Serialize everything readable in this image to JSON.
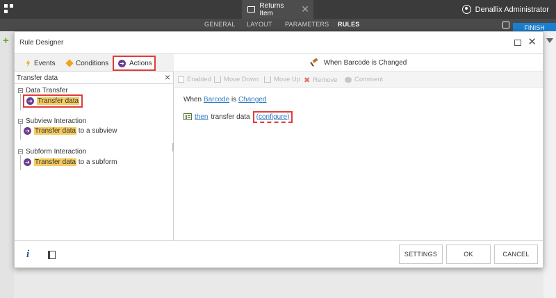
{
  "app": {
    "doc_tab_title": "Returns Item",
    "user_name": "Denallix Administrator"
  },
  "nav": {
    "items": [
      "GENERAL",
      "LAYOUT",
      "PARAMETERS",
      "RULES"
    ],
    "active": "RULES",
    "finish_label": "FINISH"
  },
  "dialog": {
    "title": "Rule Designer",
    "tabs": {
      "events": "Events",
      "conditions": "Conditions",
      "actions": "Actions"
    },
    "search": {
      "value": "Transfer data"
    },
    "tree": [
      {
        "group": "Data Transfer",
        "item_highlight": "Transfer data",
        "item_suffix": ""
      },
      {
        "group": "Subview Interaction",
        "item_highlight": "Transfer data",
        "item_suffix": " to a subview"
      },
      {
        "group": "Subform Interaction",
        "item_highlight": "Transfer data",
        "item_suffix": " to a subform"
      }
    ],
    "rule_header": "When Barcode is Changed",
    "toolbar": {
      "enabled": "Enabled",
      "move_down": "Move Down",
      "move_up": "Move Up",
      "remove": "Remove",
      "comment": "Comment"
    },
    "rule": {
      "when": "When",
      "control": "Barcode",
      "is": "is",
      "event": "Changed",
      "then": "then",
      "action_text": "transfer data",
      "configure": "(configure)"
    },
    "footer": {
      "settings": "SETTINGS",
      "ok": "OK",
      "cancel": "CANCEL"
    }
  },
  "colors": {
    "topbar": "#3b3b3b",
    "finish": "#1b7fd0",
    "highlight_box": "#e23a3a",
    "search_highlight": "#f6cb5f",
    "link": "#2f7bc3",
    "action_icon": "#6b3d8f"
  }
}
